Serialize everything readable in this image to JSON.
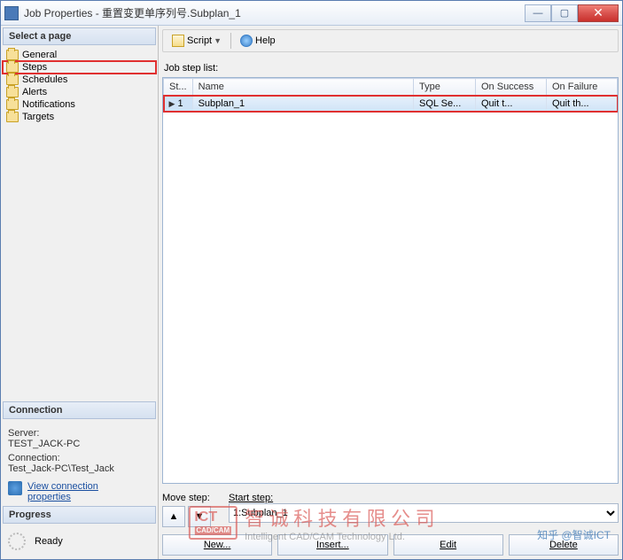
{
  "window": {
    "title": "Job Properties - 重置变更单序列号.Subplan_1"
  },
  "win_btns": {
    "min": "—",
    "max": "▢",
    "close": "✕"
  },
  "sidebar": {
    "select_page_hdr": "Select a page",
    "items": [
      {
        "label": "General"
      },
      {
        "label": "Steps"
      },
      {
        "label": "Schedules"
      },
      {
        "label": "Alerts"
      },
      {
        "label": "Notifications"
      },
      {
        "label": "Targets"
      }
    ],
    "selected_index": 1,
    "connection_hdr": "Connection",
    "connection": {
      "server_label": "Server:",
      "server_value": "TEST_JACK-PC",
      "conn_label": "Connection:",
      "conn_value": "Test_Jack-PC\\Test_Jack",
      "view_link_l1": "View connection",
      "view_link_l2": "properties"
    },
    "progress_hdr": "Progress",
    "progress_status": "Ready"
  },
  "toolbar": {
    "script": "Script",
    "help": "Help"
  },
  "main": {
    "job_step_list_label": "Job step list:",
    "columns": {
      "step": "St...",
      "name": "Name",
      "type": "Type",
      "on_success": "On Success",
      "on_failure": "On Failure"
    },
    "rows": [
      {
        "step": "1",
        "name": "Subplan_1",
        "type": "SQL Se...",
        "on_success": "Quit t...",
        "on_failure": "Quit th..."
      }
    ],
    "move_step_label": "Move step:",
    "arrow_up": "▲",
    "arrow_down": "▼",
    "start_step_label": "Start step:",
    "start_step_value": "1:Subplan_1",
    "buttons": {
      "new": "New...",
      "insert": "Insert...",
      "edit": "Edit",
      "delete": "Delete"
    }
  },
  "watermark": {
    "badge": "ICT",
    "badge_sub": "CAD/CAM",
    "cn": "智 诚 科 技 有 限 公 司",
    "en": "Intelligent CAD/CAM Technology Ltd."
  },
  "zhihu": "知乎 @智诚ICT"
}
